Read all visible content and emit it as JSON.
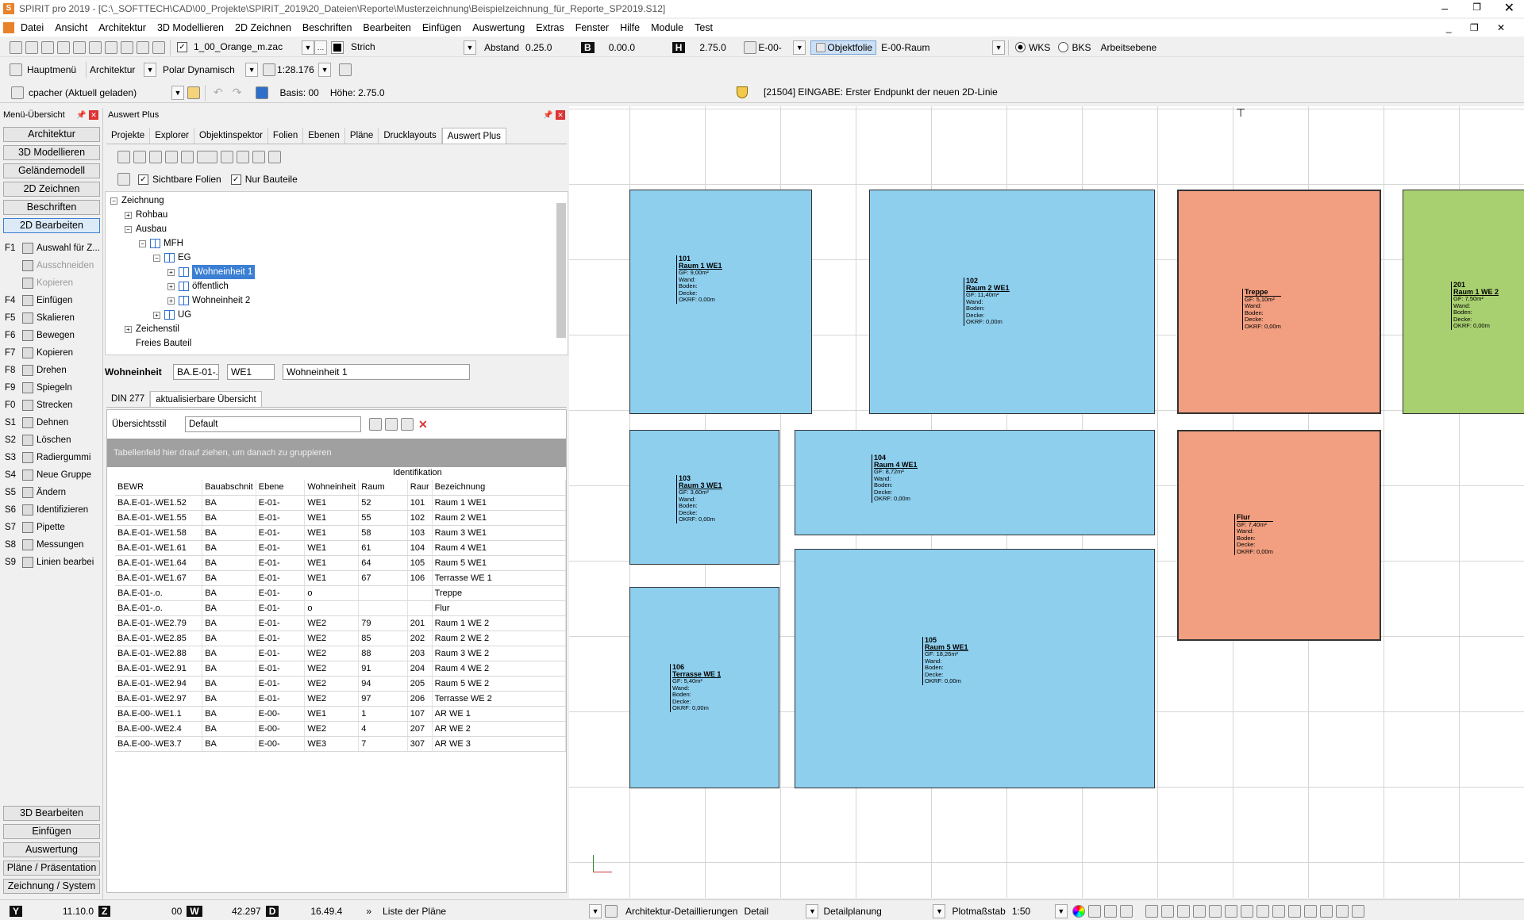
{
  "window": {
    "title": "SPIRIT pro 2019  - [C:\\_SOFTTECH\\CAD\\00_Projekte\\SPIRIT_2019\\20_Dateien\\Reporte\\Musterzeichnung\\Beispielzeichnung_für_Reporte_SP2019.S12]"
  },
  "menu": [
    "Datei",
    "Ansicht",
    "Architektur",
    "3D Modellieren",
    "2D Zeichnen",
    "Beschriften",
    "Bearbeiten",
    "Einfügen",
    "Auswertung",
    "Extras",
    "Fenster",
    "Hilfe",
    "Module",
    "Test"
  ],
  "toolbar1": {
    "layer_file": "1_00_Orange_m.zac",
    "line_style": "Strich",
    "abstand_label": "Abstand",
    "abstand_value": "0.25.0",
    "b_label": "B",
    "b_value": "0.00.0",
    "h_label": "H",
    "h_value": "2.75.0",
    "floor": "E-00-",
    "objektfolie": "Objektfolie",
    "room_layer": "E-00-Raum",
    "wks": "WKS",
    "bks": "BKS",
    "arbeitsebene": "Arbeitsebene"
  },
  "toolbar2": {
    "hauptmenu": "Hauptmenü",
    "architektur": "Architektur",
    "polar": "Polar Dynamisch",
    "scale": "1:28.176"
  },
  "toolbar3": {
    "user": "cpacher (Aktuell geladen)",
    "basis": "Basis: 00",
    "hoehe": "Höhe: 2.75.0",
    "prompt": "[21504] EINGABE: Erster Endpunkt der neuen 2D-Linie"
  },
  "menu_panel": {
    "title": "Menü-Übersicht",
    "top_buttons": [
      "Architektur",
      "3D Modellieren",
      "Geländemodell",
      "2D Zeichnen",
      "Beschriften",
      "2D Bearbeiten"
    ],
    "functions": [
      {
        "key": "F1",
        "label": "Auswahl für Z..."
      },
      {
        "key": "",
        "label": "Ausschneiden"
      },
      {
        "key": "",
        "label": "Kopieren"
      },
      {
        "key": "F4",
        "label": "Einfügen"
      },
      {
        "key": "F5",
        "label": "Skalieren"
      },
      {
        "key": "F6",
        "label": "Bewegen"
      },
      {
        "key": "F7",
        "label": "Kopieren"
      },
      {
        "key": "F8",
        "label": "Drehen"
      },
      {
        "key": "F9",
        "label": "Spiegeln"
      },
      {
        "key": "F0",
        "label": "Strecken"
      },
      {
        "key": "S1",
        "label": "Dehnen"
      },
      {
        "key": "S2",
        "label": "Löschen"
      },
      {
        "key": "S3",
        "label": "Radiergummi"
      },
      {
        "key": "S4",
        "label": "Neue Gruppe"
      },
      {
        "key": "S5",
        "label": "Ändern"
      },
      {
        "key": "S6",
        "label": "Identifizieren"
      },
      {
        "key": "S7",
        "label": "Pipette"
      },
      {
        "key": "S8",
        "label": "Messungen"
      },
      {
        "key": "S9",
        "label": "Linien bearbei"
      }
    ],
    "bottom_buttons": [
      "3D Bearbeiten",
      "Einfügen",
      "Auswertung",
      "Pläne / Präsentation",
      "Zeichnung / System"
    ]
  },
  "auswert": {
    "title": "Auswert Plus",
    "tabs": [
      "Projekte",
      "Explorer",
      "Objektinspektor",
      "Folien",
      "Ebenen",
      "Pläne",
      "Drucklayouts",
      "Auswert Plus"
    ],
    "check1": "Sichtbare Folien",
    "check2": "Nur Bauteile",
    "tree": [
      "Zeichnung",
      "Rohbau",
      "Ausbau",
      "MFH",
      "EG",
      "Wohneinheit 1",
      "öffentlich",
      "Wohneinheit 2",
      "UG",
      "Zeichenstil",
      "Freies Bauteil"
    ],
    "we_label": "Wohneinheit",
    "we_f1": "BA.E-01-.",
    "we_f2": "WE1",
    "we_f3": "Wohneinheit 1",
    "subtabs": [
      "DIN 277",
      "aktualisierbare Übersicht"
    ],
    "stil_label": "Übersichtsstil",
    "stil_value": "Default",
    "group_hint": "Tabellenfeld hier drauf ziehen, um danach zu gruppieren",
    "group_header": "Identifikation",
    "columns": [
      "BEWR",
      "Bauabschnit",
      "Ebene",
      "Wohneinheit",
      "Raum",
      "Raur",
      "Bezeichnung"
    ],
    "rows": [
      [
        "BA.E-01-.WE1.52",
        "BA",
        "E-01-",
        "WE1",
        "52",
        "101",
        "Raum 1 WE1"
      ],
      [
        "BA.E-01-.WE1.55",
        "BA",
        "E-01-",
        "WE1",
        "55",
        "102",
        "Raum 2 WE1"
      ],
      [
        "BA.E-01-.WE1.58",
        "BA",
        "E-01-",
        "WE1",
        "58",
        "103",
        "Raum 3 WE1"
      ],
      [
        "BA.E-01-.WE1.61",
        "BA",
        "E-01-",
        "WE1",
        "61",
        "104",
        "Raum 4 WE1"
      ],
      [
        "BA.E-01-.WE1.64",
        "BA",
        "E-01-",
        "WE1",
        "64",
        "105",
        "Raum 5 WE1"
      ],
      [
        "BA.E-01-.WE1.67",
        "BA",
        "E-01-",
        "WE1",
        "67",
        "106",
        "Terrasse WE 1"
      ],
      [
        "BA.E-01-.o.",
        "BA",
        "E-01-",
        "o",
        "",
        "",
        "Treppe"
      ],
      [
        "BA.E-01-.o.",
        "BA",
        "E-01-",
        "o",
        "",
        "",
        "Flur"
      ],
      [
        "BA.E-01-.WE2.79",
        "BA",
        "E-01-",
        "WE2",
        "79",
        "201",
        "Raum 1 WE 2"
      ],
      [
        "BA.E-01-.WE2.85",
        "BA",
        "E-01-",
        "WE2",
        "85",
        "202",
        "Raum 2 WE 2"
      ],
      [
        "BA.E-01-.WE2.88",
        "BA",
        "E-01-",
        "WE2",
        "88",
        "203",
        "Raum 3 WE 2"
      ],
      [
        "BA.E-01-.WE2.91",
        "BA",
        "E-01-",
        "WE2",
        "91",
        "204",
        "Raum 4 WE 2"
      ],
      [
        "BA.E-01-.WE2.94",
        "BA",
        "E-01-",
        "WE2",
        "94",
        "205",
        "Raum 5 WE 2"
      ],
      [
        "BA.E-01-.WE2.97",
        "BA",
        "E-01-",
        "WE2",
        "97",
        "206",
        "Terrasse WE 2"
      ],
      [
        "BA.E-00-.WE1.1",
        "BA",
        "E-00-",
        "WE1",
        "1",
        "107",
        "AR WE 1"
      ],
      [
        "BA.E-00-.WE2.4",
        "BA",
        "E-00-",
        "WE2",
        "4",
        "207",
        "AR WE 2"
      ],
      [
        "BA.E-00-.WE3.7",
        "BA",
        "E-00-",
        "WE3",
        "7",
        "307",
        "AR WE 3"
      ]
    ]
  },
  "rooms": [
    {
      "num": "101",
      "name": "Raum 1 WE1",
      "gf": "GF:    9,00m²",
      "color": "#8ecfee"
    },
    {
      "num": "102",
      "name": "Raum 2 WE1",
      "gf": "GF:    11,40m²",
      "color": "#8ecfee"
    },
    {
      "num": "",
      "name": "Treppe",
      "gf": "GF:    5,10m²",
      "color": "#f19f80"
    },
    {
      "num": "201",
      "name": "Raum 1 WE 2",
      "gf": "GF:    7,50m²",
      "color": "#a8d070"
    },
    {
      "num": "103",
      "name": "Raum 3 WE1",
      "gf": "GF:    3,60m²",
      "color": "#8ecfee"
    },
    {
      "num": "104",
      "name": "Raum 4 WE1",
      "gf": "GF:    8,72m²",
      "color": "#8ecfee"
    },
    {
      "num": "",
      "name": "Flur",
      "gf": "GF:    7,40m²",
      "color": "#f19f80"
    },
    {
      "num": "106",
      "name": "Terrasse WE 1",
      "gf": "GF:    5,40m²",
      "color": "#8ecfee"
    },
    {
      "num": "105",
      "name": "Raum 5 WE1",
      "gf": "GF:    18,26m²",
      "color": "#8ecfee"
    }
  ],
  "room_lines": [
    "Wand:",
    "Boden:",
    "Decke:",
    "OKRF: 0,00m"
  ],
  "status": {
    "y_label": "Y",
    "y_value": "11.10.0",
    "z_label": "Z",
    "z_value": "00",
    "w_label": "W",
    "w_value": "42.297",
    "d_label": "D",
    "d_value": "16.49.4",
    "plans": "Liste der Pläne",
    "detail_label": "Architektur-Detaillierungen",
    "detail_value": "Detail",
    "planning": "Detailplanung",
    "plot_label": "Plotmaßstab",
    "plot_value": "1:50"
  }
}
